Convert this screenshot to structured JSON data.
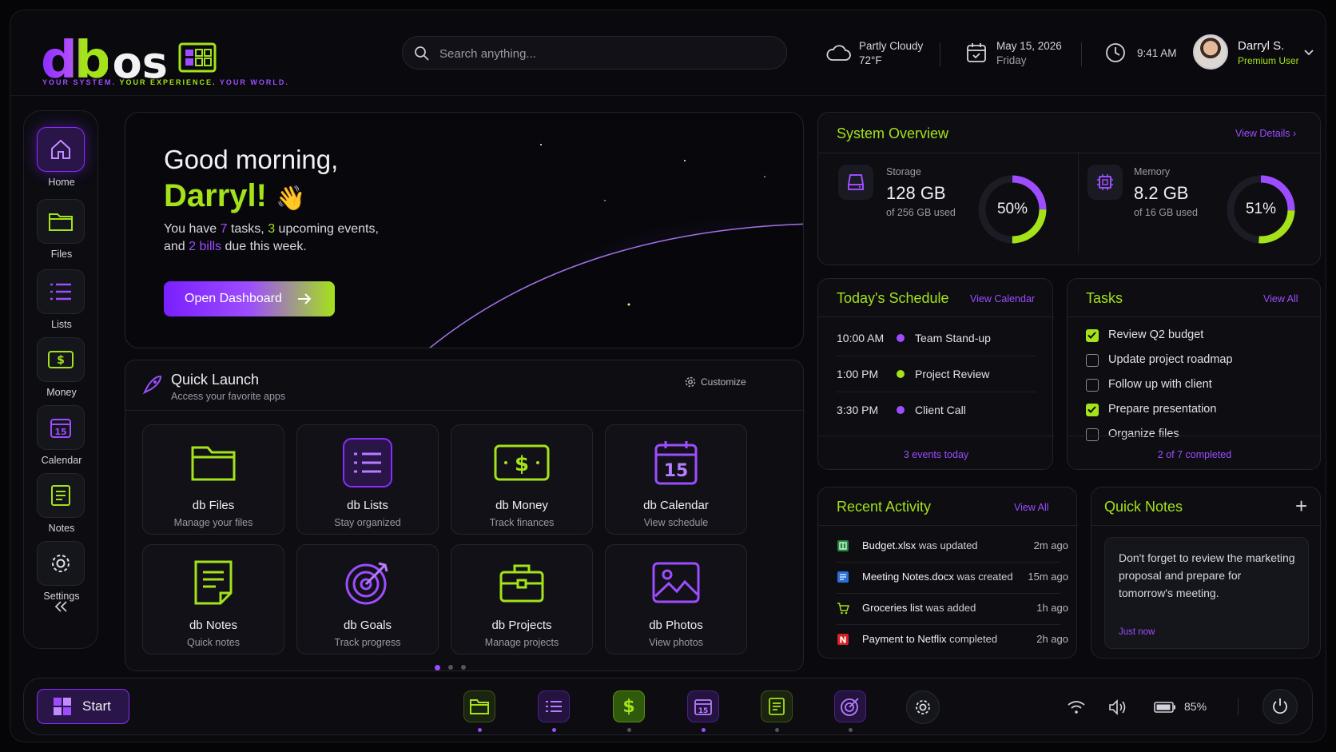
{
  "brand": {
    "logo_db": "db",
    "logo_os": "os",
    "tagline_1": "YOUR SYSTEM.",
    "tagline_2": "YOUR EXPERIENCE.",
    "tagline_3": "YOUR WORLD."
  },
  "search": {
    "placeholder": "Search anything..."
  },
  "header": {
    "weather": {
      "condition": "Partly Cloudy",
      "temp": "72°F"
    },
    "date": {
      "date": "May 15, 2026",
      "day": "Friday"
    },
    "time": "9:41 AM",
    "user": {
      "name": "Darryl S.",
      "role": "Premium User"
    }
  },
  "sidebar": {
    "items": [
      {
        "label": "Home"
      },
      {
        "label": "Files"
      },
      {
        "label": "Lists"
      },
      {
        "label": "Money"
      },
      {
        "label": "Calendar"
      },
      {
        "label": "Notes"
      },
      {
        "label": "Settings"
      }
    ]
  },
  "hero": {
    "greeting": "Good morning,",
    "name": "Darryl!",
    "wave": "👋",
    "line_1a": "You have ",
    "tasks_count": "7",
    "line_1b": " tasks, ",
    "events_count": "3",
    "line_1c": " upcoming events,",
    "line_2a": "and ",
    "bills": "2 bills",
    "line_2b": " due this week.",
    "button": "Open Dashboard"
  },
  "quick_launch": {
    "title": "Quick Launch",
    "subtitle": "Access your favorite apps",
    "customize": "Customize",
    "apps": [
      {
        "title": "db Files",
        "subtitle": "Manage your files"
      },
      {
        "title": "db Lists",
        "subtitle": "Stay organized"
      },
      {
        "title": "db Money",
        "subtitle": "Track finances"
      },
      {
        "title": "db Calendar",
        "subtitle": "View schedule"
      },
      {
        "title": "db Notes",
        "subtitle": "Quick notes"
      },
      {
        "title": "db Goals",
        "subtitle": "Track progress"
      },
      {
        "title": "db Projects",
        "subtitle": "Manage projects"
      },
      {
        "title": "db Photos",
        "subtitle": "View photos"
      }
    ],
    "calendar_day": "15"
  },
  "system": {
    "title": "System Overview",
    "link": "View Details",
    "storage": {
      "label": "Storage",
      "value": "128 GB",
      "sub": "of 256 GB used",
      "percent": "50%",
      "fraction": 0.5
    },
    "memory": {
      "label": "Memory",
      "value": "8.2 GB",
      "sub": "of 16 GB used",
      "percent": "51%",
      "fraction": 0.51
    }
  },
  "schedule": {
    "title": "Today's Schedule",
    "link": "View Calendar",
    "footer": "3 events today",
    "events": [
      {
        "time": "10:00 AM",
        "name": "Team Stand-up",
        "color": "#9d4dff"
      },
      {
        "time": "1:00 PM",
        "name": "Project Review",
        "color": "#a4e21a"
      },
      {
        "time": "3:30 PM",
        "name": "Client Call",
        "color": "#9d4dff"
      }
    ]
  },
  "tasks": {
    "title": "Tasks",
    "link": "View All",
    "footer": "2 of 7 completed",
    "items": [
      {
        "label": "Review Q2 budget",
        "done": true
      },
      {
        "label": "Update project roadmap",
        "done": false
      },
      {
        "label": "Follow up with client",
        "done": false
      },
      {
        "label": "Prepare presentation",
        "done": true
      },
      {
        "label": "Organize files",
        "done": false
      }
    ]
  },
  "activity": {
    "title": "Recent Activity",
    "link": "View All",
    "items": [
      {
        "bold": "Budget.xlsx",
        "rest": " was updated",
        "time": "2m ago",
        "icon": "spreadsheet-icon"
      },
      {
        "bold": "Meeting Notes.docx",
        "rest": " was created",
        "time": "15m ago",
        "icon": "document-icon"
      },
      {
        "bold": "Groceries list",
        "rest": " was added",
        "time": "1h ago",
        "icon": "cart-icon"
      },
      {
        "bold": "Payment to Netflix",
        "rest": " completed",
        "time": "2h ago",
        "icon": "netflix-icon"
      }
    ]
  },
  "notes": {
    "title": "Quick Notes",
    "add": "+",
    "text": "Don't forget to review the marketing proposal and prepare for tomorrow's meeting.",
    "time": "Just now"
  },
  "taskbar": {
    "start": "Start",
    "battery": "85%",
    "calendar_day": "15"
  },
  "colors": {
    "accent_purple": "#9d4dff",
    "accent_green": "#a4e21a",
    "background": "#0a0a0e"
  }
}
